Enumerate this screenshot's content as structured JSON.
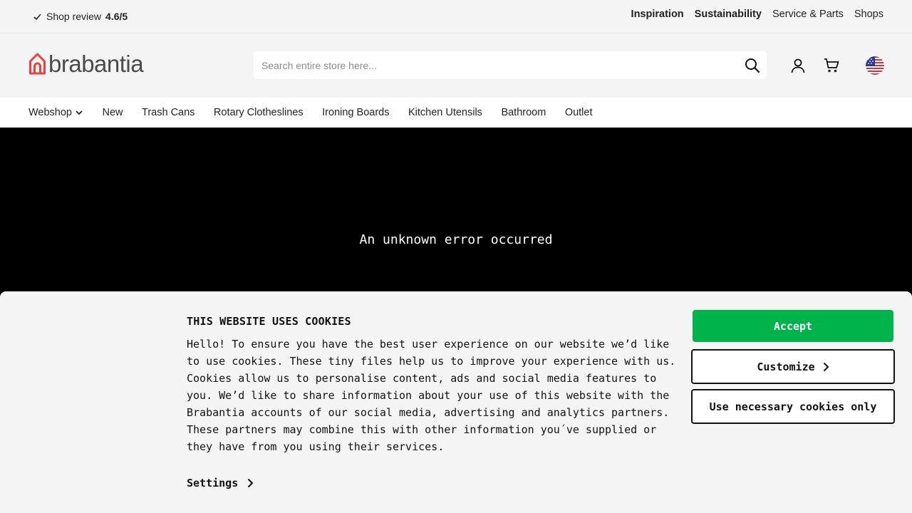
{
  "topbar": {
    "review_prefix": "Shop review",
    "review_score": "4.6/5",
    "links": [
      "Inspiration",
      "Sustainability",
      "Service & Parts",
      "Shops"
    ]
  },
  "header": {
    "logo_text": "brabantia",
    "search_placeholder": "Search entire store here...",
    "brand_color": "#e8423b"
  },
  "nav": {
    "items": [
      "Webshop",
      "New",
      "Trash Cans",
      "Rotary Clotheslines",
      "Ironing Boards",
      "Kitchen Utensils",
      "Bathroom",
      "Outlet"
    ]
  },
  "hero": {
    "error_message": "An unknown error occurred"
  },
  "cookie": {
    "title": "THIS WEBSITE USES COOKIES",
    "body": "Hello! To ensure you have the best user experience on our website we’d like to use cookies. These tiny files help us to improve your experience with us. Cookies allow us to personalise content, ads and social media features to you. We’d like to share information about your use of this website with the Brabantia accounts of our social media, advertising and analytics partners. These partners may combine this with other information you´ve supplied or they have from you using their services.",
    "settings_label": "Settings",
    "accept_label": "Accept",
    "customize_label": "Customize",
    "necessary_label": "Use necessary cookies only",
    "accept_color": "#00b34a"
  }
}
